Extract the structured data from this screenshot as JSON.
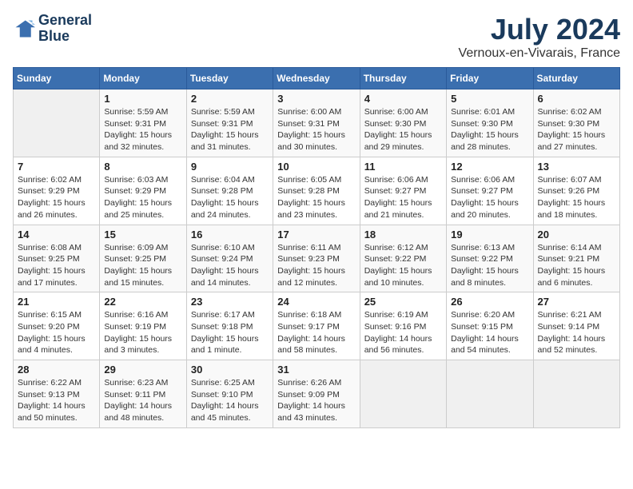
{
  "header": {
    "logo_line1": "General",
    "logo_line2": "Blue",
    "month": "July 2024",
    "location": "Vernoux-en-Vivarais, France"
  },
  "weekdays": [
    "Sunday",
    "Monday",
    "Tuesday",
    "Wednesday",
    "Thursday",
    "Friday",
    "Saturday"
  ],
  "weeks": [
    [
      {
        "day": "",
        "info": ""
      },
      {
        "day": "1",
        "info": "Sunrise: 5:59 AM\nSunset: 9:31 PM\nDaylight: 15 hours\nand 32 minutes."
      },
      {
        "day": "2",
        "info": "Sunrise: 5:59 AM\nSunset: 9:31 PM\nDaylight: 15 hours\nand 31 minutes."
      },
      {
        "day": "3",
        "info": "Sunrise: 6:00 AM\nSunset: 9:31 PM\nDaylight: 15 hours\nand 30 minutes."
      },
      {
        "day": "4",
        "info": "Sunrise: 6:00 AM\nSunset: 9:30 PM\nDaylight: 15 hours\nand 29 minutes."
      },
      {
        "day": "5",
        "info": "Sunrise: 6:01 AM\nSunset: 9:30 PM\nDaylight: 15 hours\nand 28 minutes."
      },
      {
        "day": "6",
        "info": "Sunrise: 6:02 AM\nSunset: 9:30 PM\nDaylight: 15 hours\nand 27 minutes."
      }
    ],
    [
      {
        "day": "7",
        "info": "Sunrise: 6:02 AM\nSunset: 9:29 PM\nDaylight: 15 hours\nand 26 minutes."
      },
      {
        "day": "8",
        "info": "Sunrise: 6:03 AM\nSunset: 9:29 PM\nDaylight: 15 hours\nand 25 minutes."
      },
      {
        "day": "9",
        "info": "Sunrise: 6:04 AM\nSunset: 9:28 PM\nDaylight: 15 hours\nand 24 minutes."
      },
      {
        "day": "10",
        "info": "Sunrise: 6:05 AM\nSunset: 9:28 PM\nDaylight: 15 hours\nand 23 minutes."
      },
      {
        "day": "11",
        "info": "Sunrise: 6:06 AM\nSunset: 9:27 PM\nDaylight: 15 hours\nand 21 minutes."
      },
      {
        "day": "12",
        "info": "Sunrise: 6:06 AM\nSunset: 9:27 PM\nDaylight: 15 hours\nand 20 minutes."
      },
      {
        "day": "13",
        "info": "Sunrise: 6:07 AM\nSunset: 9:26 PM\nDaylight: 15 hours\nand 18 minutes."
      }
    ],
    [
      {
        "day": "14",
        "info": "Sunrise: 6:08 AM\nSunset: 9:25 PM\nDaylight: 15 hours\nand 17 minutes."
      },
      {
        "day": "15",
        "info": "Sunrise: 6:09 AM\nSunset: 9:25 PM\nDaylight: 15 hours\nand 15 minutes."
      },
      {
        "day": "16",
        "info": "Sunrise: 6:10 AM\nSunset: 9:24 PM\nDaylight: 15 hours\nand 14 minutes."
      },
      {
        "day": "17",
        "info": "Sunrise: 6:11 AM\nSunset: 9:23 PM\nDaylight: 15 hours\nand 12 minutes."
      },
      {
        "day": "18",
        "info": "Sunrise: 6:12 AM\nSunset: 9:22 PM\nDaylight: 15 hours\nand 10 minutes."
      },
      {
        "day": "19",
        "info": "Sunrise: 6:13 AM\nSunset: 9:22 PM\nDaylight: 15 hours\nand 8 minutes."
      },
      {
        "day": "20",
        "info": "Sunrise: 6:14 AM\nSunset: 9:21 PM\nDaylight: 15 hours\nand 6 minutes."
      }
    ],
    [
      {
        "day": "21",
        "info": "Sunrise: 6:15 AM\nSunset: 9:20 PM\nDaylight: 15 hours\nand 4 minutes."
      },
      {
        "day": "22",
        "info": "Sunrise: 6:16 AM\nSunset: 9:19 PM\nDaylight: 15 hours\nand 3 minutes."
      },
      {
        "day": "23",
        "info": "Sunrise: 6:17 AM\nSunset: 9:18 PM\nDaylight: 15 hours\nand 1 minute."
      },
      {
        "day": "24",
        "info": "Sunrise: 6:18 AM\nSunset: 9:17 PM\nDaylight: 14 hours\nand 58 minutes."
      },
      {
        "day": "25",
        "info": "Sunrise: 6:19 AM\nSunset: 9:16 PM\nDaylight: 14 hours\nand 56 minutes."
      },
      {
        "day": "26",
        "info": "Sunrise: 6:20 AM\nSunset: 9:15 PM\nDaylight: 14 hours\nand 54 minutes."
      },
      {
        "day": "27",
        "info": "Sunrise: 6:21 AM\nSunset: 9:14 PM\nDaylight: 14 hours\nand 52 minutes."
      }
    ],
    [
      {
        "day": "28",
        "info": "Sunrise: 6:22 AM\nSunset: 9:13 PM\nDaylight: 14 hours\nand 50 minutes."
      },
      {
        "day": "29",
        "info": "Sunrise: 6:23 AM\nSunset: 9:11 PM\nDaylight: 14 hours\nand 48 minutes."
      },
      {
        "day": "30",
        "info": "Sunrise: 6:25 AM\nSunset: 9:10 PM\nDaylight: 14 hours\nand 45 minutes."
      },
      {
        "day": "31",
        "info": "Sunrise: 6:26 AM\nSunset: 9:09 PM\nDaylight: 14 hours\nand 43 minutes."
      },
      {
        "day": "",
        "info": ""
      },
      {
        "day": "",
        "info": ""
      },
      {
        "day": "",
        "info": ""
      }
    ]
  ]
}
